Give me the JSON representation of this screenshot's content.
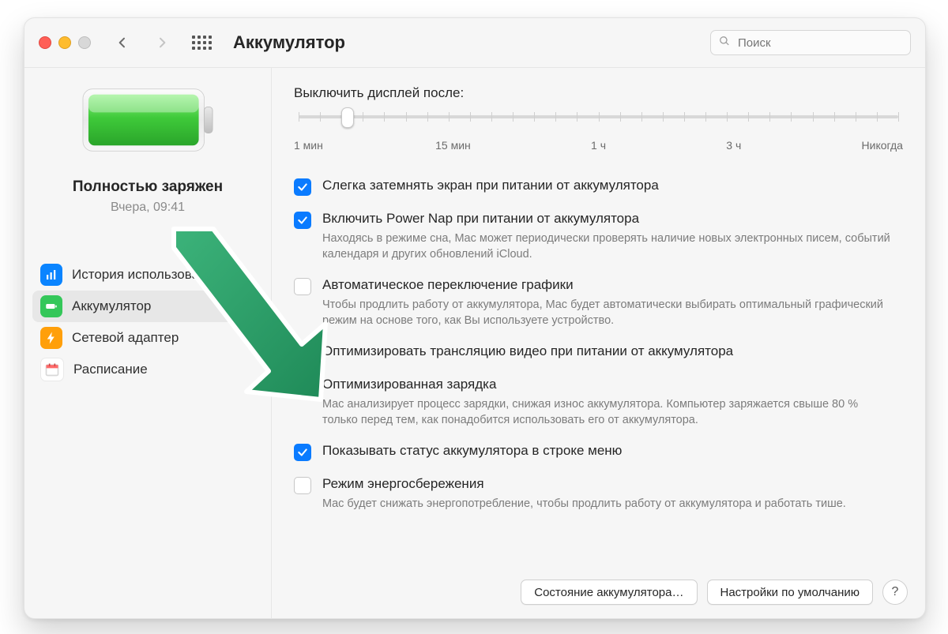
{
  "header": {
    "title": "Аккумулятор",
    "search_placeholder": "Поиск"
  },
  "hero": {
    "status": "Полностью заряжен",
    "time": "Вчера, 09:41"
  },
  "sidebar": {
    "items": [
      {
        "key": "usage",
        "label": "История использования"
      },
      {
        "key": "battery",
        "label": "Аккумулятор"
      },
      {
        "key": "power",
        "label": "Сетевой адаптер"
      },
      {
        "key": "schedule",
        "label": "Расписание"
      }
    ],
    "selected": "battery"
  },
  "slider": {
    "label": "Выключить дисплей после:",
    "marks": [
      "1 мин",
      "15 мин",
      "1 ч",
      "3 ч",
      "Никогда"
    ],
    "thumb_percent": 8
  },
  "options": [
    {
      "key": "dim",
      "checked": true,
      "label": "Слегка затемнять экран при питании от аккумулятора",
      "desc": ""
    },
    {
      "key": "powernap",
      "checked": true,
      "label": "Включить Power Nap при питании от аккумулятора",
      "desc": "Находясь в режиме сна, Mac может периодически проверять наличие новых электронных писем, событий календаря и других обновлений iCloud."
    },
    {
      "key": "gpu",
      "checked": false,
      "label": "Автоматическое переключение графики",
      "desc": "Чтобы продлить работу от аккумулятора, Mac будет автоматически выбирать оптимальный графический режим на основе того, как Вы используете устройство."
    },
    {
      "key": "video",
      "checked": true,
      "label": "Оптимизировать трансляцию видео при питании от аккумулятора",
      "desc": ""
    },
    {
      "key": "optcharge",
      "checked": true,
      "label": "Оптимизированная зарядка",
      "desc": "Mac анализирует процесс зарядки, снижая износ аккумулятора. Компьютер заряжается свыше 80 % только перед тем, как понадобится использовать его от аккумулятора."
    },
    {
      "key": "menubar",
      "checked": true,
      "label": "Показывать статус аккумулятора в строке меню",
      "desc": ""
    },
    {
      "key": "lowpower",
      "checked": false,
      "label": "Режим энергосбережения",
      "desc": "Mac будет снижать энергопотребление, чтобы продлить работу от аккумулятора и работать тише."
    }
  ],
  "footer": {
    "battery_health": "Состояние аккумулятора…",
    "restore_defaults": "Настройки по умолчанию",
    "help": "?"
  }
}
